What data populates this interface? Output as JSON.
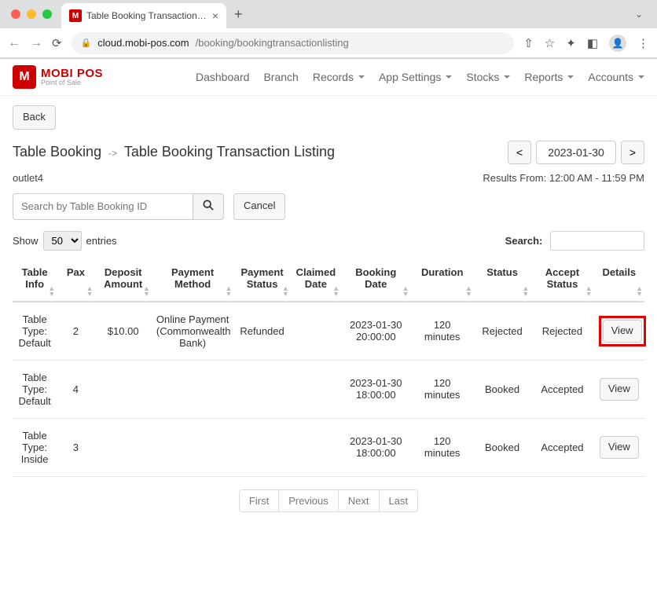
{
  "browser": {
    "tab_title": "Table Booking Transaction Listi",
    "url_host": "cloud.mobi-pos.com",
    "url_path": "/booking/bookingtransactionlisting"
  },
  "logo": {
    "main": "MOBI POS",
    "sub": "Point of Sale",
    "mark": "M"
  },
  "nav": [
    "Dashboard",
    "Branch",
    "Records",
    "App Settings",
    "Stocks",
    "Reports",
    "Accounts"
  ],
  "nav_dropdown": [
    false,
    false,
    true,
    true,
    true,
    true,
    true
  ],
  "back_label": "Back",
  "breadcrumb": {
    "root": "Table Booking",
    "current": "Table Booking Transaction Listing"
  },
  "date_nav": {
    "prev": "<",
    "date": "2023-01-30",
    "next": ">"
  },
  "outlet": "outlet4",
  "results_text": "Results From: 12:00 AM - 11:59 PM",
  "search": {
    "placeholder": "Search by Table Booking ID",
    "cancel": "Cancel"
  },
  "table_controls": {
    "show": "Show",
    "entries": "entries",
    "entries_value": "50",
    "search_label": "Search:"
  },
  "columns": [
    "Table Info",
    "Pax",
    "Deposit Amount",
    "Payment Method",
    "Payment Status",
    "Claimed Date",
    "Booking Date",
    "Duration",
    "Status",
    "Accept Status",
    "Details"
  ],
  "rows": [
    {
      "table_info": "Table Type: Default",
      "pax": "2",
      "deposit": "$10.00",
      "payment_method": "Online Payment (Commonwealth Bank)",
      "payment_status": "Refunded",
      "claimed": "",
      "booking_date": "2023-01-30 20:00:00",
      "duration": "120 minutes",
      "status": "Rejected",
      "status_class": "status-rejected",
      "accept": "Rejected",
      "accept_class": "status-rejected",
      "view": "View",
      "highlight": true
    },
    {
      "table_info": "Table Type: Default",
      "pax": "4",
      "deposit": "",
      "payment_method": "",
      "payment_status": "",
      "claimed": "",
      "booking_date": "2023-01-30 18:00:00",
      "duration": "120 minutes",
      "status": "Booked",
      "status_class": "status-booked",
      "accept": "Accepted",
      "accept_class": "status-accepted",
      "view": "View",
      "highlight": false
    },
    {
      "table_info": "Table Type: Inside",
      "pax": "3",
      "deposit": "",
      "payment_method": "",
      "payment_status": "",
      "claimed": "",
      "booking_date": "2023-01-30 18:00:00",
      "duration": "120 minutes",
      "status": "Booked",
      "status_class": "status-booked",
      "accept": "Accepted",
      "accept_class": "status-accepted",
      "view": "View",
      "highlight": false
    }
  ],
  "pagination": [
    "First",
    "Previous",
    "Next",
    "Last"
  ]
}
